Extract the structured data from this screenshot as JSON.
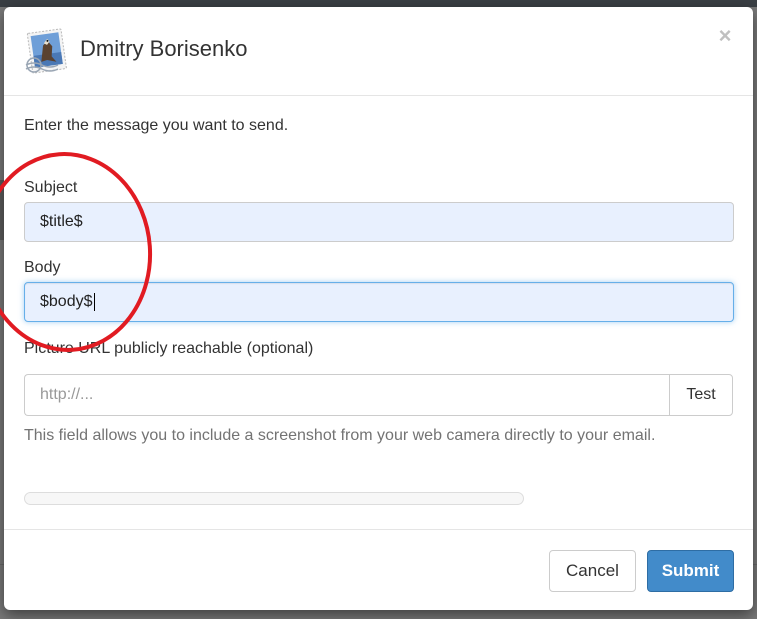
{
  "dialog": {
    "title": "Dmitry Borisenko",
    "close_glyph": "×",
    "icon": "mail-stamp-icon"
  },
  "form": {
    "intro": "Enter the message you want to send.",
    "subject": {
      "label": "Subject",
      "value": "$title$"
    },
    "body": {
      "label": "Body",
      "value": "$body$"
    },
    "picture_url": {
      "label": "Picture URL publicly reachable (optional)",
      "placeholder": "http://...",
      "value": "",
      "test_label": "Test",
      "help": "This field allows you to include a screenshot from your web camera directly to your email."
    },
    "progress": 0
  },
  "footer": {
    "cancel_label": "Cancel",
    "submit_label": "Submit"
  },
  "colors": {
    "primary": "#428bca",
    "annotation": "#e11b22",
    "autofill": "#e8f0fe"
  }
}
